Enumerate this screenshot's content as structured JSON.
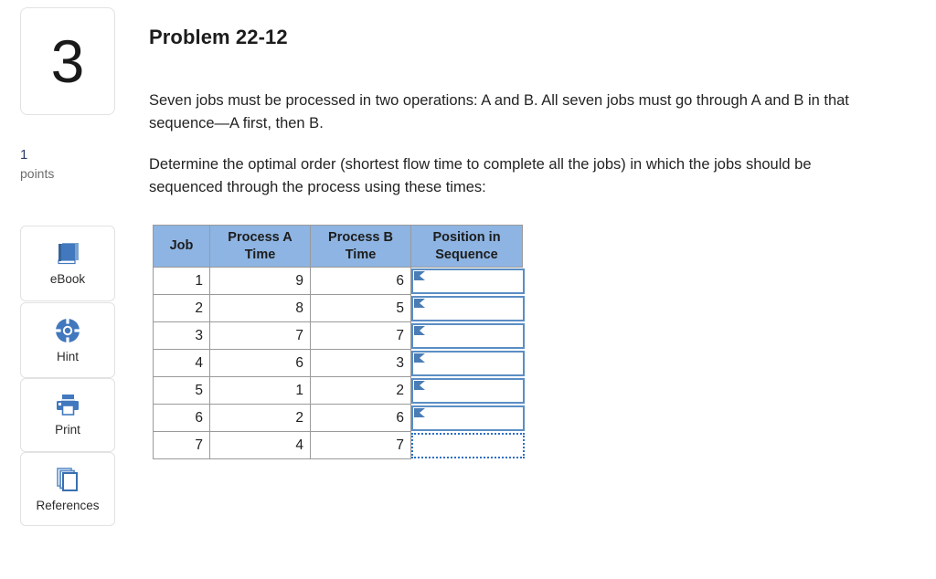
{
  "question": {
    "number": "3",
    "points_value": "1",
    "points_label": "points"
  },
  "tools": [
    {
      "label": "eBook",
      "icon": "book-icon"
    },
    {
      "label": "Hint",
      "icon": "life-preserver-icon"
    },
    {
      "label": "Print",
      "icon": "printer-icon"
    },
    {
      "label": "References",
      "icon": "stacked-pages-icon"
    }
  ],
  "problem": {
    "title": "Problem 22-12",
    "paragraph_1": "Seven jobs must be processed in two operations: A and B. All seven jobs must go through A and B in that sequence—A first, then B.",
    "paragraph_2": "Determine the optimal order (shortest flow time to complete all the jobs) in which the jobs should be sequenced through the process using these times:"
  },
  "table": {
    "headers": [
      "Job",
      "Process A Time",
      "Process B Time",
      "Position in Sequence"
    ],
    "rows": [
      {
        "job": "1",
        "process_a": "9",
        "process_b": "6",
        "position": ""
      },
      {
        "job": "2",
        "process_a": "8",
        "process_b": "5",
        "position": ""
      },
      {
        "job": "3",
        "process_a": "7",
        "process_b": "7",
        "position": ""
      },
      {
        "job": "4",
        "process_a": "6",
        "process_b": "3",
        "position": ""
      },
      {
        "job": "5",
        "process_a": "1",
        "process_b": "2",
        "position": ""
      },
      {
        "job": "6",
        "process_a": "2",
        "process_b": "6",
        "position": ""
      },
      {
        "job": "7",
        "process_a": "4",
        "process_b": "7",
        "position": ""
      }
    ]
  },
  "colors": {
    "header_blue": "#8db4e2",
    "input_border_blue": "#5b8ec4",
    "icon_blue": "#4178be",
    "points_blue": "#2c3d69"
  }
}
